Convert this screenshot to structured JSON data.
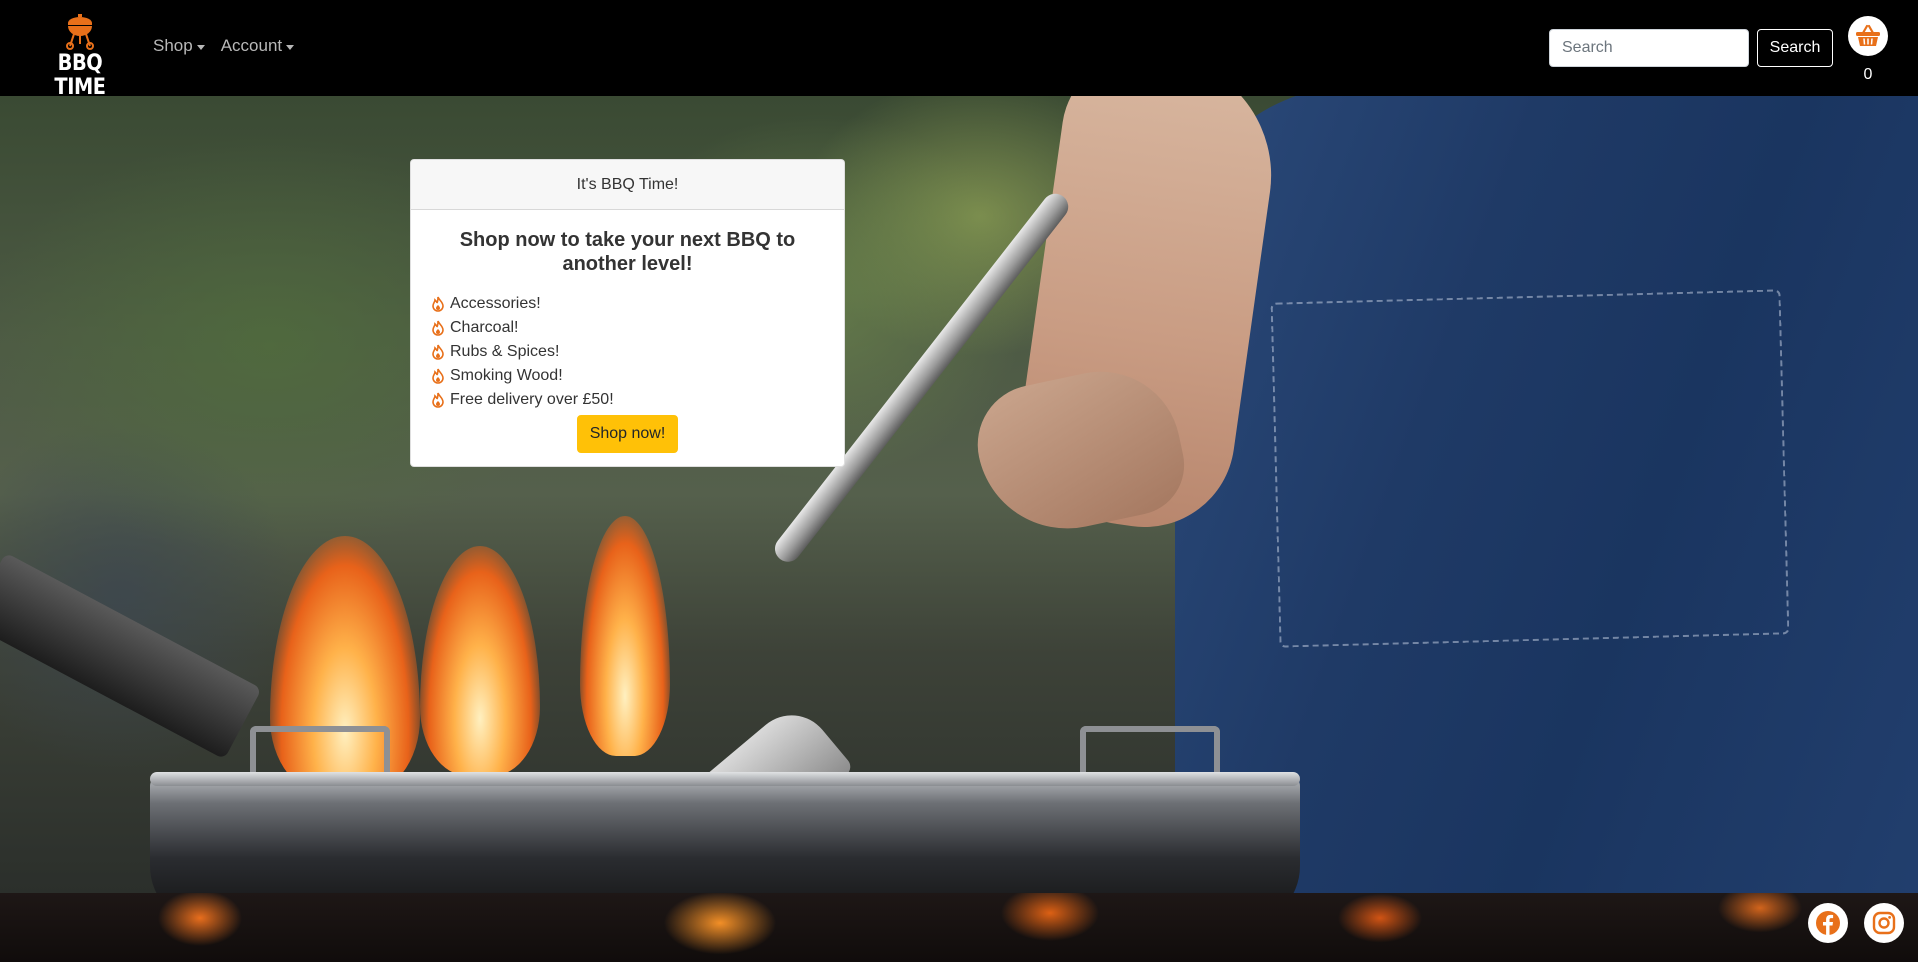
{
  "brand": {
    "name": "BBQ TIME",
    "logo_icon": "bbq-grill-icon",
    "accent": "#e8701a"
  },
  "nav": {
    "shop_label": "Shop",
    "account_label": "Account"
  },
  "search": {
    "placeholder": "Search",
    "button_label": "Search"
  },
  "basket": {
    "icon": "basket-icon",
    "count": "0"
  },
  "hero_card": {
    "header": "It's BBQ Time!",
    "title": "Shop now to take your next BBQ to another level!",
    "items": [
      "Accessories!",
      "Charcoal!",
      "Rubs & Spices!",
      "Smoking Wood!",
      "Free delivery over £50!"
    ],
    "item_icon": "fire-icon",
    "button_label": "Shop now!",
    "button_color": "#ffc107"
  },
  "footer": {
    "social": [
      {
        "name": "facebook-icon",
        "color": "#e8701a"
      },
      {
        "name": "instagram-icon",
        "color": "#e8701a"
      }
    ]
  }
}
